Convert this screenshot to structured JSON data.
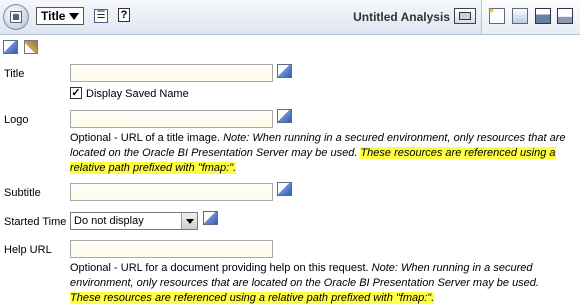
{
  "toolbar": {
    "view_selector": "Title",
    "analysis_title": "Untitled Analysis"
  },
  "form": {
    "title_label": "Title",
    "title_value": "",
    "display_saved_name_label": "Display Saved Name",
    "display_saved_name_checked": true,
    "logo_label": "Logo",
    "logo_value": "",
    "logo_note_plain": "Optional - URL of a title image. ",
    "logo_note_italic": "Note: When running in a secured environment, only resources that are located on the Oracle BI Presentation Server may be used.",
    "logo_note_highlight": "These resources are referenced using a relative path prefixed with \"fmap:\".",
    "subtitle_label": "Subtitle",
    "subtitle_value": "",
    "started_time_label": "Started Time",
    "started_time_value": "Do not display",
    "help_url_label": "Help URL",
    "help_url_value": "",
    "help_note_plain": "Optional - URL for a document providing help on this request. ",
    "help_note_italic": "Note: When running in a secured environment, only resources that are located on the Oracle BI Presentation Server may be used.",
    "help_note_highlight": "These resources are referenced using a relative path prefixed with \"fmap:\"."
  },
  "icons": [
    "analysis-icon",
    "dropdown-arrow-icon",
    "properties-icon",
    "help-icon",
    "display-icon",
    "new-icon",
    "open-icon",
    "save-icon",
    "print-icon",
    "edit-format-icon",
    "clear-format-icon",
    "edit-text-icon"
  ],
  "colors": {
    "highlight": "#ffff44",
    "toolbar": "#dfe6f1"
  }
}
